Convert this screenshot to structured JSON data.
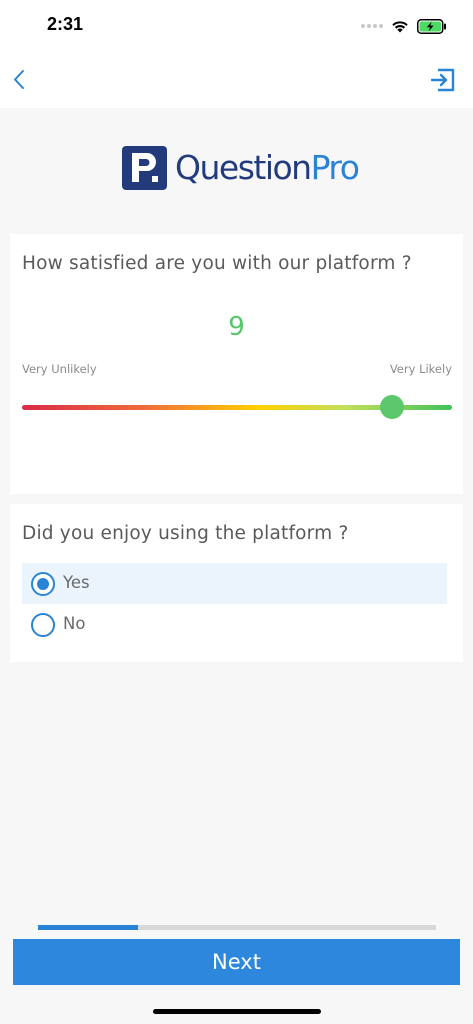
{
  "status_bar": {
    "time": "2:31"
  },
  "logo": {
    "text_main": "Question",
    "text_accent": "Pro",
    "brand_color": "#233a7d",
    "accent_color": "#2a84d6"
  },
  "questions": [
    {
      "text": "How satisfied are you with our platform ?",
      "type": "slider",
      "value": "9",
      "min_label": "Very Unlikely",
      "max_label": "Very Likely",
      "level": 0.86
    },
    {
      "text": "Did you enjoy using the platform ?",
      "type": "radio",
      "options": [
        {
          "label": "Yes",
          "selected": true
        },
        {
          "label": "No",
          "selected": false
        }
      ]
    }
  ],
  "progress": {
    "fraction": 0.25
  },
  "footer": {
    "next_label": "Next"
  },
  "icons": {
    "back": "chevron-left-icon",
    "exit": "exit-icon",
    "wifi": "wifi-icon",
    "battery": "battery-charging-icon"
  }
}
